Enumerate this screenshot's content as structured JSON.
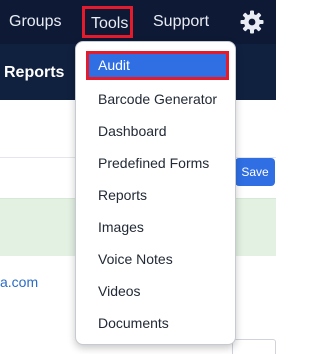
{
  "topnav": {
    "groups_label": "Groups",
    "tools_label": "Tools",
    "support_label": "Support",
    "settings_icon": "gear-icon"
  },
  "subbar": {
    "title": "Reports"
  },
  "content": {
    "save_label": "Save",
    "email_fragment": "a.com"
  },
  "tools_menu": {
    "items": [
      {
        "label": "Audit"
      },
      {
        "label": "Barcode Generator"
      },
      {
        "label": "Dashboard"
      },
      {
        "label": "Predefined Forms"
      },
      {
        "label": "Reports"
      },
      {
        "label": "Images"
      },
      {
        "label": "Voice Notes"
      },
      {
        "label": "Videos"
      },
      {
        "label": "Documents"
      }
    ]
  },
  "colors": {
    "navbar": "#0e1a35",
    "highlight": "#e41b2c",
    "accent": "#2f6fe3"
  }
}
